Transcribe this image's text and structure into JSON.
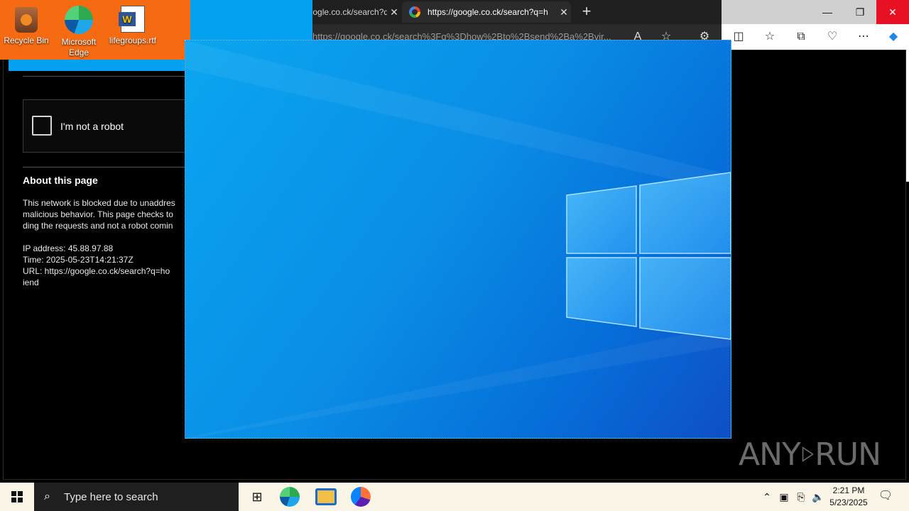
{
  "browser": {
    "tabs": [
      {
        "title": "google.co.ck/search?q=g"
      },
      {
        "title": "https://google.co.ck/search?q=h"
      }
    ],
    "new_tab": "+",
    "address_url": "https://google.co.ck/search%3Fq%3Dhow%2Bto%2Bsend%2Ba%2Bvir...",
    "controls": {
      "minimize": "—",
      "restore": "❐",
      "close": "✕"
    },
    "toolbar_icons": [
      "read-aloud-icon",
      "favorite-star-icon",
      "extensions-icon",
      "split-screen-icon",
      "favorites-icon",
      "collections-icon",
      "browser-essentials-icon",
      "more-icon",
      "copilot-icon"
    ]
  },
  "page": {
    "captcha_label": "I'm not a robot",
    "about_title": "About this page",
    "about_lines": [
      "This network is blocked due to unaddres",
      "malicious behavior. This page checks to",
      "ding the requests and not a robot comin"
    ],
    "ip_line": "IP address: 45.88.97.88",
    "time_line": "Time: 2025-05-23T14:21:37Z",
    "url_line": "URL: https://google.co.ck/search?q=ho",
    "url_line_2": "iend"
  },
  "desktop": {
    "icons": [
      {
        "label": "Recycle Bin"
      },
      {
        "label": "Microsoft Edge"
      },
      {
        "label": "lifegroups.rtf"
      }
    ]
  },
  "watermark": {
    "left": "ANY",
    "right": "RUN"
  },
  "taskbar": {
    "search_placeholder": "Type here to search",
    "time": "2:21 PM",
    "date": "5/23/2025"
  },
  "colors": {
    "wallpaper_light": "#0aa6f0",
    "wallpaper_dark": "#0f4fc6",
    "close_red": "#e81123",
    "desktop_orange": "#f66a12"
  }
}
